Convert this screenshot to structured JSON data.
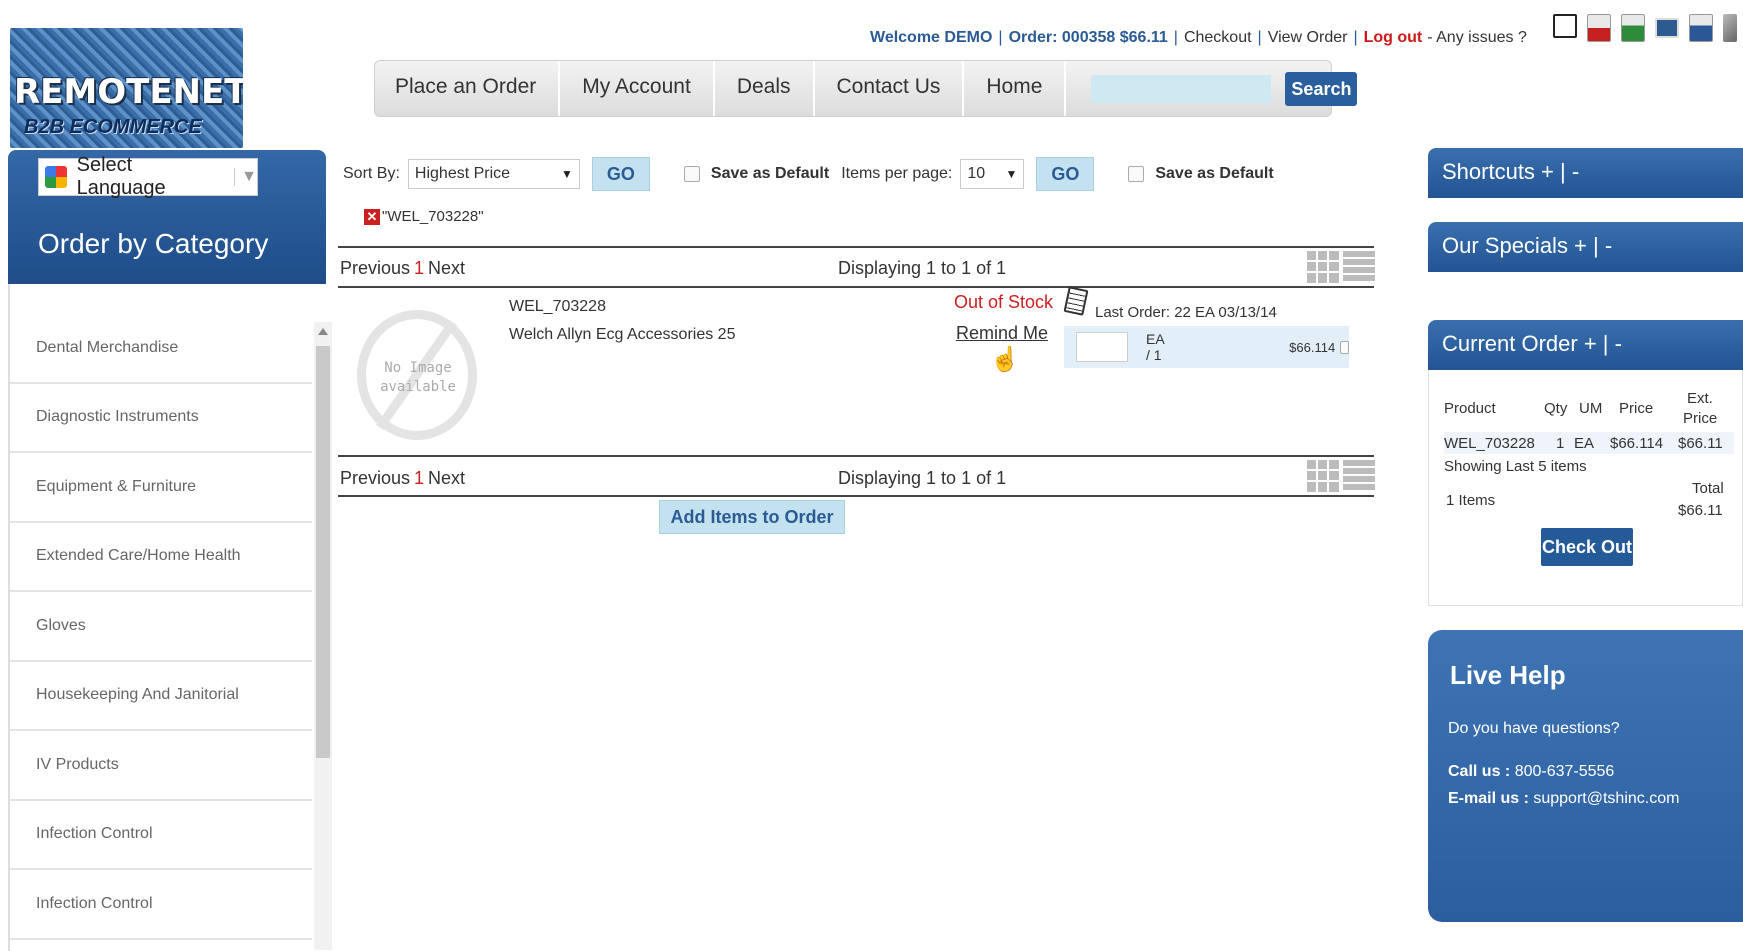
{
  "logo": {
    "line1": "REMOTENET",
    "line2": "B2B ECOMMERCE"
  },
  "topbar": {
    "welcome": "Welcome DEMO",
    "order": "Order: 000358 $66.11",
    "checkout": "Checkout",
    "view_order": "View Order",
    "logout": "Log out",
    "issues": "- Any issues ?",
    "icons": [
      "print-icon",
      "pdf-icon",
      "excel-icon",
      "image-icon",
      "word-icon",
      "v-icon"
    ]
  },
  "nav": {
    "tabs": [
      "Place an Order",
      "My Account",
      "Deals",
      "Contact Us",
      "Home"
    ],
    "search_placeholder": "",
    "search_button": "Search"
  },
  "sidebar": {
    "language": "Select Language",
    "title": "Order by Category",
    "categories": [
      "Dental Merchandise",
      "Diagnostic Instruments",
      "Equipment & Furniture",
      "Extended Care/Home Health",
      "Gloves",
      "Housekeeping And Janitorial",
      "IV Products",
      "Infection Control",
      "Infection Control"
    ]
  },
  "sortbar": {
    "sort_label": "Sort By:",
    "sort_value": "Highest Price",
    "go": "GO",
    "save_default": "Save as Default",
    "per_page_label": "Items per page:",
    "per_page_value": "10"
  },
  "filter": {
    "tag": "\"WEL_703228\""
  },
  "pager": {
    "previous": "Previous",
    "page": "1",
    "next": "Next",
    "displaying": "Displaying 1 to 1 of 1"
  },
  "product": {
    "no_image": "No Image available",
    "sku": "WEL_703228",
    "description": "Welch Allyn Ecg Accessories 25",
    "status": "Out of Stock",
    "remind": "Remind Me",
    "last_order": "Last Order: 22 EA 03/13/14",
    "um": "EA / 1",
    "price": "$66.114"
  },
  "add_button": "Add Items to Order",
  "right": {
    "shortcuts": "Shortcuts + | -",
    "specials": "Our Specials + | -",
    "current_order": "Current Order + | -",
    "cols": {
      "product": "Product",
      "qty": "Qty",
      "um": "UM",
      "price": "Price",
      "ext1": "Ext.",
      "ext2": "Price"
    },
    "row": {
      "product": "WEL_703228",
      "qty": "1",
      "um": "EA",
      "price": "$66.114",
      "ext": "$66.11"
    },
    "showing": "Showing Last 5 items",
    "items": "1 Items",
    "total_label": "Total",
    "total_value": "$66.11",
    "checkout": "Check Out"
  },
  "live": {
    "title": "Live Help",
    "question": "Do you have questions?",
    "call_label": "Call us :",
    "call_value": "800-637-5556",
    "email_label": "E-mail us :",
    "email_value": "support@tshinc.com"
  },
  "colors": {
    "primary": "#2b5b94",
    "accent_red": "#cc1f1f",
    "button_light": "#c4e1ef"
  }
}
